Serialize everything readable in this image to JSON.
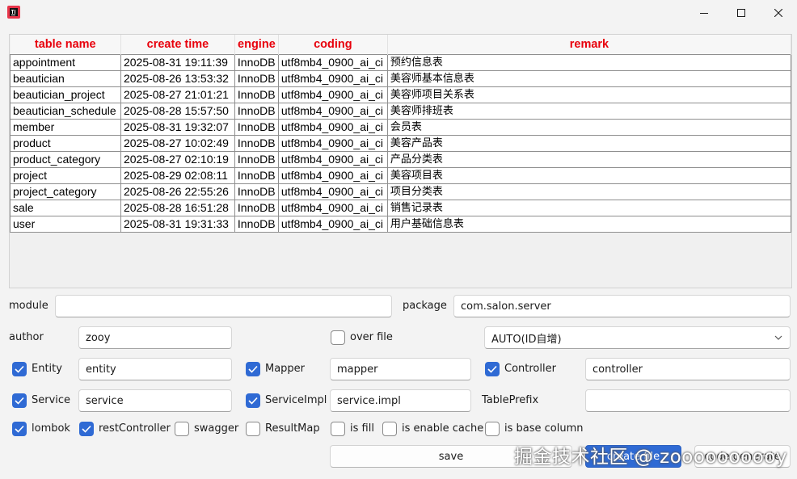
{
  "window": {
    "title": ""
  },
  "table": {
    "columns": [
      "table name",
      "create time",
      "engine",
      "coding",
      "remark"
    ],
    "rows": [
      [
        "appointment",
        "2025-08-31 19:11:39",
        "InnoDB",
        "utf8mb4_0900_ai_ci",
        "预约信息表"
      ],
      [
        "beautician",
        "2025-08-26 13:53:32",
        "InnoDB",
        "utf8mb4_0900_ai_ci",
        "美容师基本信息表"
      ],
      [
        "beautician_project",
        "2025-08-27 21:01:21",
        "InnoDB",
        "utf8mb4_0900_ai_ci",
        "美容师项目关系表"
      ],
      [
        "beautician_schedule",
        "2025-08-28 15:57:50",
        "InnoDB",
        "utf8mb4_0900_ai_ci",
        "美容师排班表"
      ],
      [
        "member",
        "2025-08-31 19:32:07",
        "InnoDB",
        "utf8mb4_0900_ai_ci",
        "会员表"
      ],
      [
        "product",
        "2025-08-27 10:02:49",
        "InnoDB",
        "utf8mb4_0900_ai_ci",
        "美容产品表"
      ],
      [
        "product_category",
        "2025-08-27 02:10:19",
        "InnoDB",
        "utf8mb4_0900_ai_ci",
        "产品分类表"
      ],
      [
        "project",
        "2025-08-29 02:08:11",
        "InnoDB",
        "utf8mb4_0900_ai_ci",
        "美容项目表"
      ],
      [
        "project_category",
        "2025-08-26 22:55:26",
        "InnoDB",
        "utf8mb4_0900_ai_ci",
        "项目分类表"
      ],
      [
        "sale",
        "2025-08-28 16:51:28",
        "InnoDB",
        "utf8mb4_0900_ai_ci",
        "销售记录表"
      ],
      [
        "user",
        "2025-08-31 19:31:33",
        "InnoDB",
        "utf8mb4_0900_ai_ci",
        "用户基础信息表"
      ]
    ]
  },
  "form": {
    "module_label": "module",
    "module_value": "",
    "package_label": "package",
    "package_value": "com.salon.server",
    "author_label": "author",
    "author_value": "zooy",
    "over_file_label": "over file",
    "over_file_checked": false,
    "id_type_value": "AUTO(ID自增)",
    "entity_label": "Entity",
    "entity_checked": true,
    "entity_value": "entity",
    "mapper_label": "Mapper",
    "mapper_checked": true,
    "mapper_value": "mapper",
    "controller_label": "Controller",
    "controller_checked": true,
    "controller_value": "controller",
    "service_label": "Service",
    "service_checked": true,
    "service_value": "service",
    "serviceimpl_label": "ServiceImpl",
    "serviceimpl_checked": true,
    "serviceimpl_value": "service.impl",
    "table_prefix_label": "TablePrefix",
    "table_prefix_value": "",
    "lombok_label": "lombok",
    "lombok_checked": true,
    "rest_controller_label": "restController",
    "rest_controller_checked": true,
    "swagger_label": "swagger",
    "swagger_checked": false,
    "result_map_label": "ResultMap",
    "result_map_checked": false,
    "is_fill_label": "is fill",
    "is_fill_checked": false,
    "is_enable_cache_label": "is enable cache",
    "is_enable_cache_checked": false,
    "is_base_column_label": "is base column",
    "is_base_column_checked": false
  },
  "buttons": {
    "save": "save",
    "create_file": "create file",
    "code_generate": "code generate"
  },
  "watermark": "掘金技术社区 @ zoooooooooy",
  "colors": {
    "accent": "#2f6ad4",
    "header_text": "#e8000c",
    "grid_border": "#8f8f8f"
  },
  "icons": {
    "app": "app-icon",
    "minimize": "minimize-icon",
    "maximize": "maximize-icon",
    "close": "close-icon",
    "chevron": "chevron-down-icon",
    "check": "checkmark-icon"
  }
}
